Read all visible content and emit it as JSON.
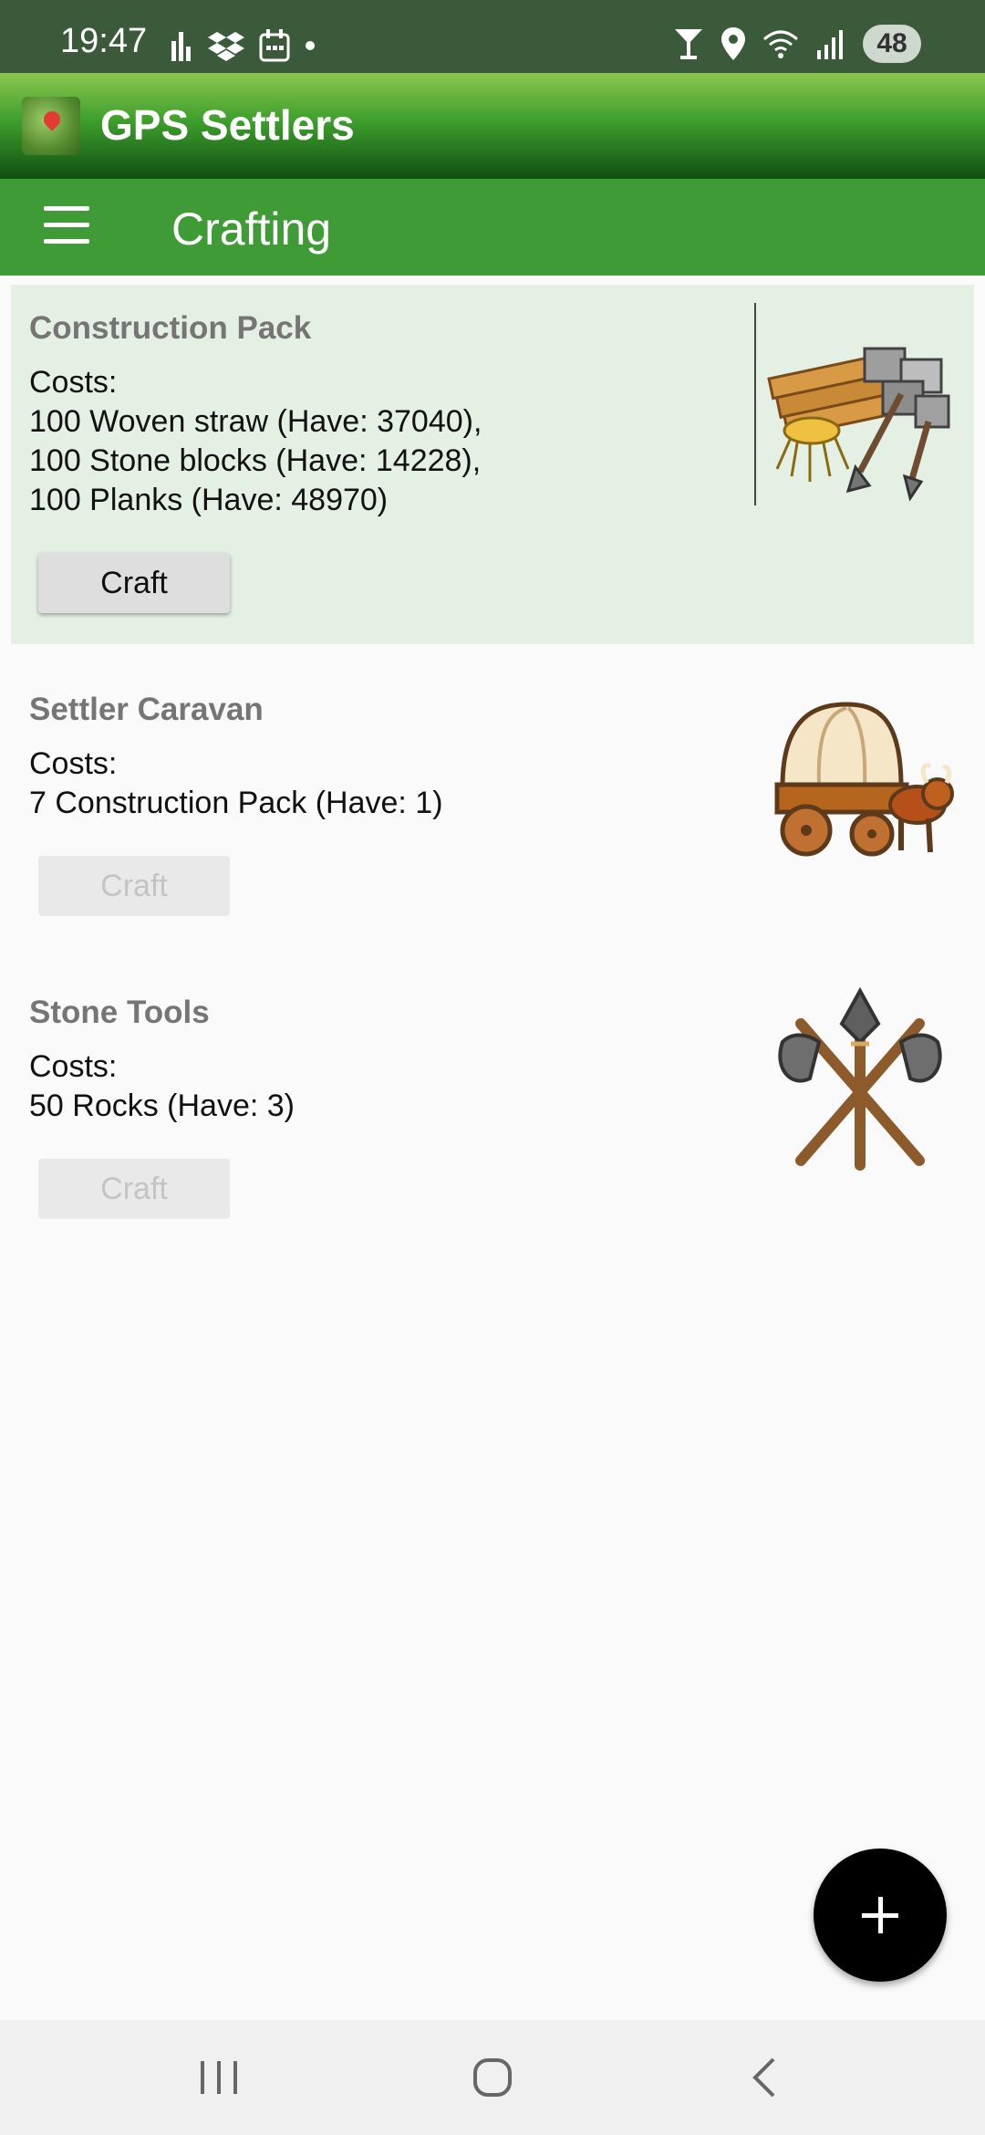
{
  "status_bar": {
    "time": "19:47",
    "left_icons": [
      "activity-icon",
      "dropbox-icon",
      "calendar-icon",
      "dot-icon"
    ],
    "right_icons": [
      "cocktail-icon",
      "location-icon",
      "wifi-icon",
      "signal-icon"
    ],
    "battery": "48"
  },
  "app": {
    "name": "GPS Settlers"
  },
  "toolbar": {
    "title": "Crafting",
    "menu_icon": "hamburger-menu-icon"
  },
  "recipes": [
    {
      "title": "Construction Pack",
      "costs": "Costs:\n100 Woven straw (Have: 37040),\n100 Stone blocks (Have: 14228),\n100 Planks (Have: 48970)",
      "button": "Craft",
      "enabled": true,
      "icon": "construction-pack-icon"
    },
    {
      "title": "Settler Caravan",
      "costs": "Costs:\n7 Construction Pack (Have: 1)",
      "button": "Craft",
      "enabled": false,
      "icon": "covered-wagon-icon"
    },
    {
      "title": "Stone Tools",
      "costs": "Costs:\n50 Rocks (Have: 3)",
      "button": "Craft",
      "enabled": false,
      "icon": "stone-axes-icon"
    }
  ],
  "fab": {
    "icon": "plus-icon"
  },
  "nav_bar": {
    "icons": [
      "recent-apps-icon",
      "home-icon",
      "back-icon"
    ]
  },
  "colors": {
    "status_bar": "#3b5a3a",
    "toolbar": "#3f9b35",
    "highlight_card": "#e4f0e4",
    "fab": "#000000"
  }
}
